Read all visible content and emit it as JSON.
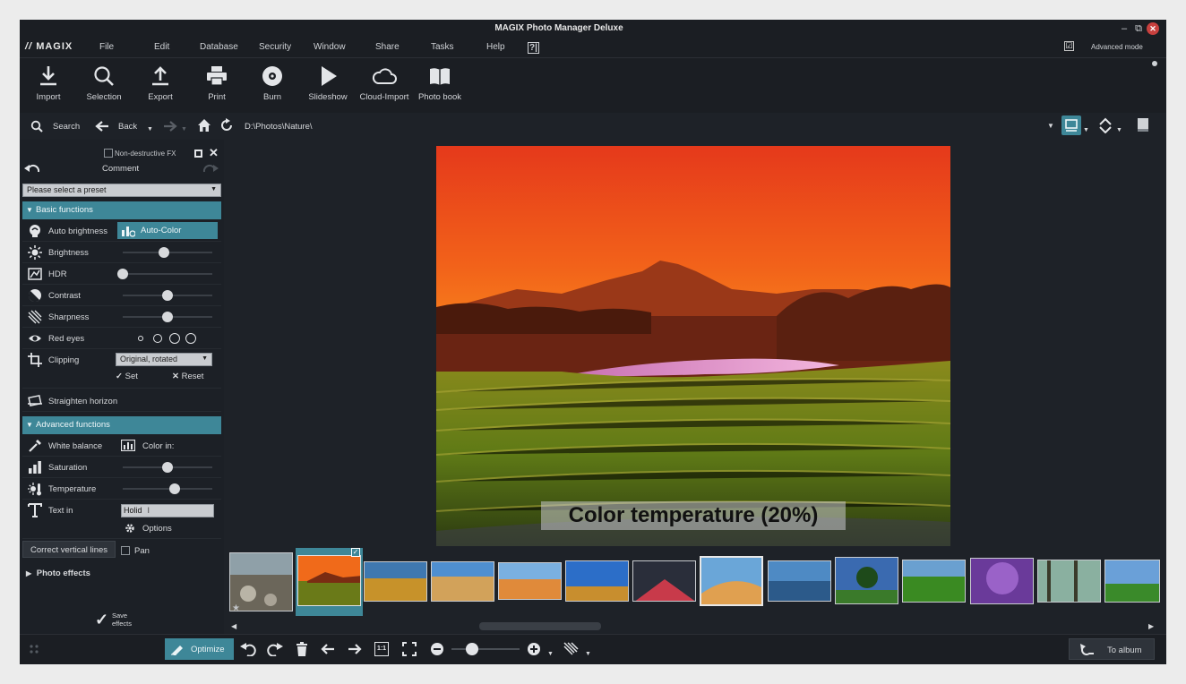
{
  "window": {
    "title": "MAGIX Photo Manager Deluxe",
    "logo": "MAGIX",
    "minimize": "–",
    "restore": "⧉",
    "close": "✕"
  },
  "menu": {
    "items": [
      "File",
      "Edit",
      "Database",
      "Security",
      "Window",
      "Share",
      "Tasks",
      "Help"
    ],
    "help_icon": "?|",
    "advanced_mode_checked": "☑",
    "advanced_mode_label": "Advanced mode"
  },
  "toolbar": {
    "items": [
      {
        "label": "Import",
        "icon": "download-icon"
      },
      {
        "label": "Selection",
        "icon": "magnifier-icon"
      },
      {
        "label": "Export",
        "icon": "upload-icon"
      },
      {
        "label": "Print",
        "icon": "printer-icon"
      },
      {
        "label": "Burn",
        "icon": "disc-icon"
      },
      {
        "label": "Slideshow",
        "icon": "play-icon"
      },
      {
        "label": "Cloud-Import",
        "icon": "cloud-icon"
      },
      {
        "label": "Photo book",
        "icon": "book-icon"
      }
    ]
  },
  "nav": {
    "search_label": "Search",
    "back_label": "Back",
    "path": "D:\\Photos\\Nature\\"
  },
  "panel": {
    "nondestructive_label": "Non-destructive FX",
    "comment_label": "Comment",
    "preset_placeholder": "Please select a preset",
    "basic_section": "Basic functions",
    "advanced_section": "Advanced functions",
    "photo_effects_label": "Photo effects",
    "save_effects_line1": "Save",
    "save_effects_line2": "effects",
    "basic_rows": {
      "auto_brightness": "Auto brightness",
      "auto_color": "Auto-Color",
      "brightness": "Brightness",
      "hdr": "HDR",
      "contrast": "Contrast",
      "sharpness": "Sharpness",
      "red_eyes": "Red eyes",
      "clipping": "Clipping",
      "clipping_value": "Original, rotated",
      "set": "Set",
      "reset": "Reset",
      "straighten": "Straighten horizon"
    },
    "advanced_rows": {
      "white_balance": "White balance",
      "color_in": "Color in:",
      "saturation": "Saturation",
      "temperature": "Temperature",
      "text_in": "Text in",
      "text_value": "Holid",
      "options": "Options",
      "correct_vertical": "Correct vertical lines",
      "pan": "Pan"
    },
    "slider_levels": {
      "brightness": 0.46,
      "hdr": 0.0,
      "contrast": 0.5,
      "sharpness": 0.5,
      "saturation": 0.5,
      "temperature": 0.58
    }
  },
  "viewer": {
    "overlay_caption": "Color temperature (20%)"
  },
  "bottom": {
    "optimize_label": "Optimize",
    "to_album_label": "To album",
    "zoom_1to1": "1:1"
  },
  "colors": {
    "accent": "#3e8798",
    "background": "#1e2228"
  }
}
